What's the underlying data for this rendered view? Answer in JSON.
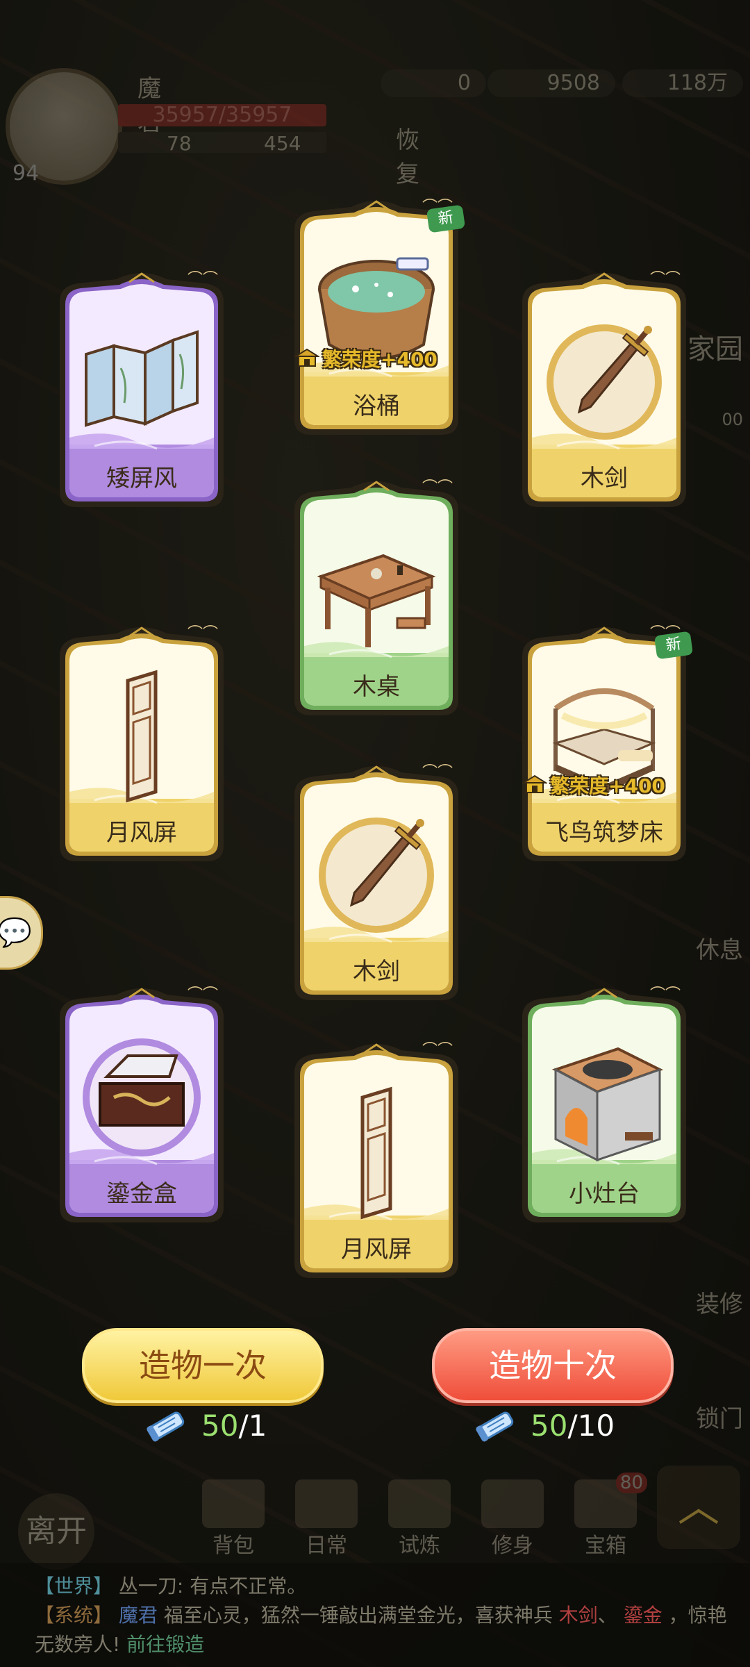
{
  "player": {
    "name": "魔君",
    "hp": "35957/35957",
    "level": "94",
    "stat_a": "78",
    "stat_b": "454"
  },
  "resources": {
    "jade": "0",
    "silver": "9508",
    "coin": "118万"
  },
  "recover_label": "恢复",
  "side_labels": {
    "home": "家园",
    "rest": "休息",
    "build": "装修",
    "lock": "锁门",
    "rest_time": "00"
  },
  "cards": [
    {
      "name": "矮屏风",
      "rarity": "purple",
      "is_new": false,
      "prosperity": ""
    },
    {
      "name": "浴桶",
      "rarity": "gold",
      "is_new": true,
      "prosperity": "繁荣度+400"
    },
    {
      "name": "木剑",
      "rarity": "gold",
      "is_new": false,
      "prosperity": ""
    },
    {
      "name": "木桌",
      "rarity": "green",
      "is_new": false,
      "prosperity": ""
    },
    {
      "name": "月风屏",
      "rarity": "gold",
      "is_new": false,
      "prosperity": ""
    },
    {
      "name": "飞鸟筑梦床",
      "rarity": "gold",
      "is_new": true,
      "prosperity": "繁荣度+400"
    },
    {
      "name": "木剑",
      "rarity": "gold",
      "is_new": false,
      "prosperity": ""
    },
    {
      "name": "鎏金盒",
      "rarity": "purple",
      "is_new": false,
      "prosperity": ""
    },
    {
      "name": "小灶台",
      "rarity": "green",
      "is_new": false,
      "prosperity": ""
    },
    {
      "name": "月风屏",
      "rarity": "gold",
      "is_new": false,
      "prosperity": ""
    }
  ],
  "new_badge": "新",
  "actions": {
    "once_label": "造物一次",
    "ten_label": "造物十次",
    "once_have": "50",
    "once_cost": "/1",
    "ten_have": "50",
    "ten_cost": "/10"
  },
  "nav": [
    "背包",
    "日常",
    "试炼",
    "修身",
    "宝箱"
  ],
  "nav_badge": "80",
  "leave_label": "离开",
  "chat": {
    "world_tag": "【世界】",
    "world_msg": "丛一刀: 有点不正常。",
    "sys_tag": "【系统】",
    "sys_name": "魔君",
    "sys_msg1": "福至心灵，猛然一锤敲出满堂金光，喜获神兵",
    "sys_item": "木剑",
    "sys_sep": "、",
    "sys_item2": "鎏金",
    "sys_msg2": "，惊艳无数旁人!",
    "sys_link": "前往锻造"
  },
  "colors": {
    "purple": "#b388e0",
    "gold": "#e8c75a",
    "green": "#8fcf7f"
  }
}
